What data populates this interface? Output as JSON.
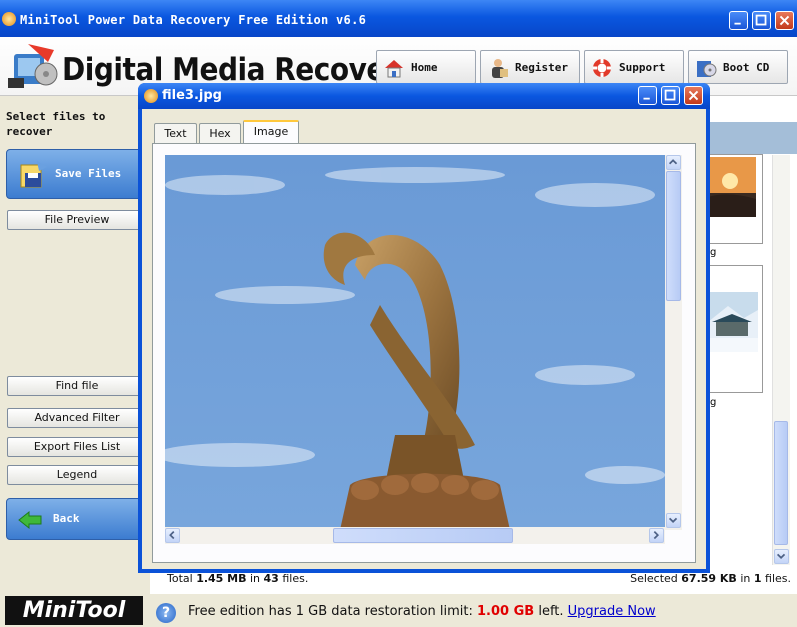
{
  "window": {
    "title": "MiniTool Power Data Recovery Free Edition v6.6"
  },
  "header": {
    "logo_text": "Digital Media Recovery",
    "buttons": [
      {
        "label": "Home",
        "icon": "home-icon"
      },
      {
        "label": "Register",
        "icon": "register-icon"
      },
      {
        "label": "Support",
        "icon": "lifebuoy-icon"
      },
      {
        "label": "Boot CD",
        "icon": "boot-cd-icon"
      }
    ]
  },
  "left_panel": {
    "select_label": "Select files to recover",
    "save_files": "Save Files",
    "file_preview": "File Preview",
    "find_file": "Find file",
    "advanced_filter": "Advanced Filter",
    "export_files_list": "Export Files List",
    "legend": "Legend",
    "back": "Back"
  },
  "thumbnails": [
    {
      "caption": "g"
    },
    {
      "caption": "g"
    }
  ],
  "status": {
    "total_prefix": "Total ",
    "total_size": "1.45 MB",
    "total_mid": " in ",
    "total_count": "43",
    "total_suffix": " files.",
    "selected_prefix": "Selected ",
    "selected_size": "67.59 KB",
    "selected_mid": " in ",
    "selected_count": "1",
    "selected_suffix": " files."
  },
  "bottom": {
    "logo": "MiniTool",
    "limit_prefix": "Free edition has 1 GB data restoration limit: ",
    "limit_left": "1.00 GB",
    "limit_suffix": " left. ",
    "upgrade_link": "Upgrade Now"
  },
  "dialog": {
    "title": "file3.jpg",
    "tabs": [
      {
        "label": "Text",
        "active": false
      },
      {
        "label": "Hex",
        "active": false
      },
      {
        "label": "Image",
        "active": true
      }
    ]
  },
  "colors": {
    "title_blue": "#0A57E0",
    "limit_red": "#E00000",
    "link_blue": "#0000CC",
    "sky_blue": "#6E9ED8"
  }
}
